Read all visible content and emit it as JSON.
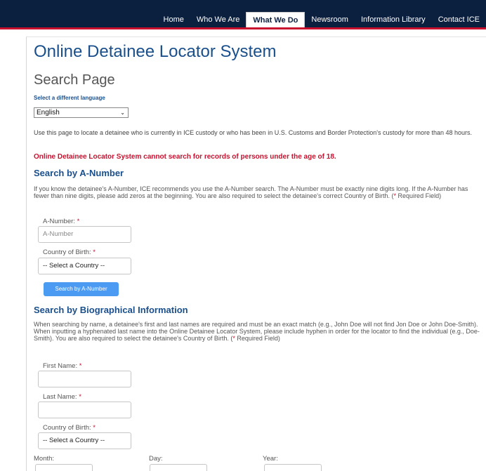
{
  "nav": {
    "items": [
      {
        "label": "Home"
      },
      {
        "label": "Who We Are"
      },
      {
        "label": "What We Do"
      },
      {
        "label": "Newsroom"
      },
      {
        "label": "Information Library"
      },
      {
        "label": "Contact ICE"
      }
    ],
    "active": "What We Do"
  },
  "page": {
    "title": "Online Detainee Locator System",
    "subtitle": "Search Page",
    "language_link": "Select a different language",
    "language_value": "English",
    "intro": "Use this page to locate a detainee who is currently in ICE custody or who has been in U.S. Customs and Border Protection's custody for more than 48 hours.",
    "warning": "Online Detainee Locator System cannot search for records of persons under the age of 18."
  },
  "anumber": {
    "title": "Search by A-Number",
    "description_main": "If you know the detainee's A-Number, ICE recommends you use the A-Number search. The A-Number must be exactly nine digits long. If the A-Number has fewer than nine digits, please add zeros at the beginning. You are also required to select the detainee's correct Country of Birth. (",
    "description_star": "*",
    "description_end": " Required Field)",
    "anumber_label": "A-Number: ",
    "anumber_placeholder": "A-Number",
    "country_label": "Country of Birth: ",
    "country_value": "-- Select a Country --",
    "button": "Search by A-Number"
  },
  "bio": {
    "title": "Search by Biographical Information",
    "description_main": "When searching by name, a detainee's first and last names are required and must be an exact match (e.g., John Doe will not find Jon Doe or John Doe-Smith). When inputting a hyphenated last name into the Online Detainee Locator System, please include hyphen in order for the locator to find the individual (e.g., Doe-Smith). You are also required to select the detainee's Country of Birth. (",
    "description_star": "*",
    "description_end": " Required Field)",
    "first_label": "First Name: ",
    "last_label": "Last Name: ",
    "country_label": "Country of Birth: ",
    "country_value": "-- Select a Country --",
    "month_label": "Month:",
    "day_label": "Day:",
    "year_label": "Year:"
  },
  "required_marker": "*"
}
